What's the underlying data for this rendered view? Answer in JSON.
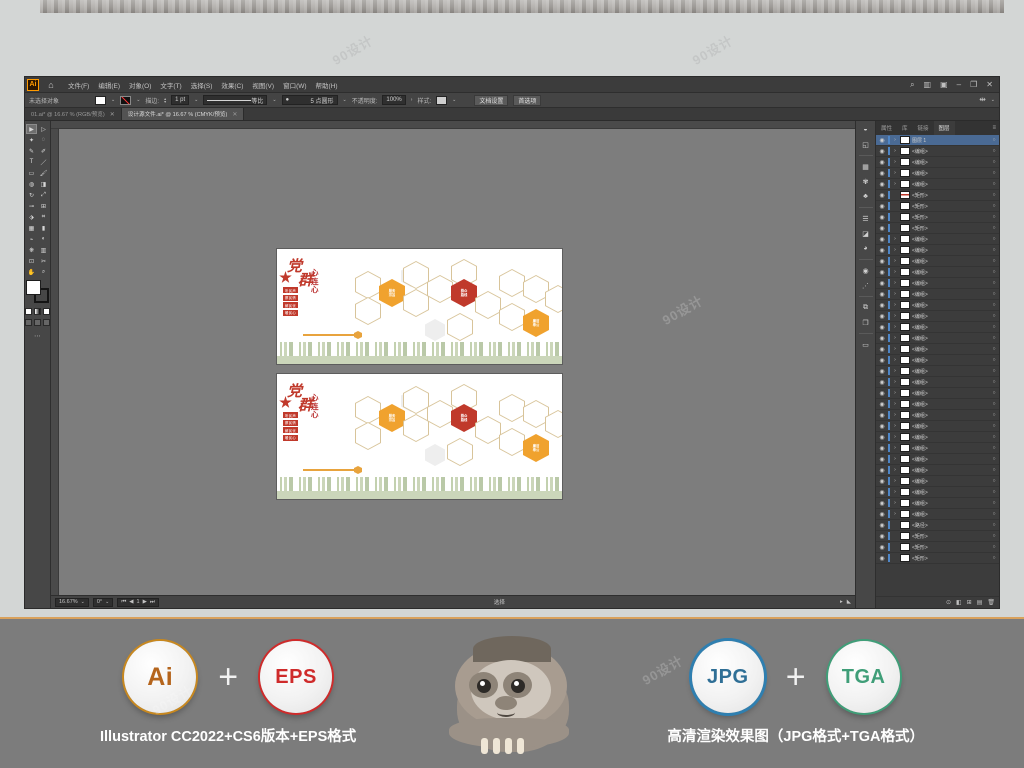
{
  "app": {
    "logo": "Ai",
    "home_icon": "home-icon",
    "menus": [
      "文件(F)",
      "编辑(E)",
      "对象(O)",
      "文字(T)",
      "选择(S)",
      "效果(C)",
      "视图(V)",
      "窗口(W)",
      "帮助(H)"
    ],
    "window_controls": {
      "search": "search-icon",
      "arrange": "arrange-documents-icon",
      "workspace": "workspace-switcher-icon",
      "minimize": "–",
      "restore": "❐",
      "close": "✕"
    }
  },
  "control_bar": {
    "selection_label": "未选择对象",
    "fill_swatch": "#ffffff",
    "stroke_swatch": "none",
    "stroke_label": "描边:",
    "stroke_weight": "1 pt",
    "stroke_profile": "等比",
    "brush_label": "5 点圆形",
    "opacity_label": "不透明度:",
    "opacity_value": "100%",
    "style_label": "样式:",
    "doc_setup_button": "文档设置",
    "preferences_button": "首选项"
  },
  "tabs": [
    {
      "title": "01.ai* @ 16.67 % (RGB/预览)",
      "active": false,
      "close": "✕"
    },
    {
      "title": "设计源文件.ai* @ 16.67 % (CMYK/预览)",
      "active": true,
      "close": "✕"
    }
  ],
  "tools": [
    "selection-tool",
    "direct-selection-tool",
    "magic-wand-tool",
    "lasso-tool",
    "pen-tool",
    "curvature-tool",
    "type-tool",
    "line-segment-tool",
    "rectangle-tool",
    "paintbrush-tool",
    "shaper-tool",
    "eraser-tool",
    "rotate-tool",
    "scale-tool",
    "width-tool",
    "free-transform-tool",
    "shape-builder-tool",
    "perspective-grid-tool",
    "mesh-tool",
    "gradient-tool",
    "eyedropper-tool",
    "blend-tool",
    "symbol-sprayer-tool",
    "column-graph-tool",
    "artboard-tool",
    "slice-tool",
    "hand-tool",
    "zoom-tool"
  ],
  "artwork": {
    "title_char_1": "党",
    "title_char_2": "群",
    "heart_text": [
      "心",
      "连",
      "心"
    ],
    "emblem": "party-emblem-icon",
    "stack_labels": [
      "听民声",
      "察民情",
      "解民忧",
      "暖民心"
    ],
    "hex_labels": [
      {
        "text": "服务\n宗旨",
        "color": "#f0a22e"
      },
      {
        "text": "群众\n路线",
        "color": "#c0392b"
      },
      {
        "text": "廉洁\n奉公",
        "color": "#f0a22e"
      }
    ]
  },
  "status_bar": {
    "zoom": "16.67%",
    "rotation": "0°",
    "artboard_nav": "1",
    "tool_name": "选择"
  },
  "panel": {
    "tabs": [
      "属性",
      "库",
      "链接",
      "图层"
    ],
    "active_tab": "图层",
    "menu_icon": "panel-menu-icon",
    "layers": [
      {
        "name": "图层 1",
        "selected": true,
        "thumb": "white",
        "expandable": true
      },
      {
        "name": "<编组>",
        "selected": false,
        "thumb": "white",
        "expandable": true
      },
      {
        "name": "<编组>",
        "selected": false,
        "thumb": "white",
        "expandable": true
      },
      {
        "name": "<编组>",
        "selected": false,
        "thumb": "white",
        "expandable": true
      },
      {
        "name": "<编组>",
        "selected": false,
        "thumb": "white",
        "expandable": true
      },
      {
        "name": "<矩形>",
        "selected": false,
        "thumb": "red",
        "expandable": false
      },
      {
        "name": "<矩形>",
        "selected": false,
        "thumb": "white",
        "expandable": false
      },
      {
        "name": "<矩形>",
        "selected": false,
        "thumb": "white",
        "expandable": false
      },
      {
        "name": "<矩形>",
        "selected": false,
        "thumb": "white",
        "expandable": false
      },
      {
        "name": "<编组>",
        "selected": false,
        "thumb": "white",
        "expandable": true
      },
      {
        "name": "<编组>",
        "selected": false,
        "thumb": "white",
        "expandable": true
      },
      {
        "name": "<编组>",
        "selected": false,
        "thumb": "white",
        "expandable": true
      },
      {
        "name": "<编组>",
        "selected": false,
        "thumb": "white",
        "expandable": true
      },
      {
        "name": "<编组>",
        "selected": false,
        "thumb": "white",
        "expandable": true
      },
      {
        "name": "<编组>",
        "selected": false,
        "thumb": "white",
        "expandable": true
      },
      {
        "name": "<编组>",
        "selected": false,
        "thumb": "white",
        "expandable": true
      },
      {
        "name": "<编组>",
        "selected": false,
        "thumb": "white",
        "expandable": true
      },
      {
        "name": "<编组>",
        "selected": false,
        "thumb": "white",
        "expandable": true
      },
      {
        "name": "<编组>",
        "selected": false,
        "thumb": "white",
        "expandable": true
      },
      {
        "name": "<编组>",
        "selected": false,
        "thumb": "white",
        "expandable": true
      },
      {
        "name": "<编组>",
        "selected": false,
        "thumb": "white",
        "expandable": true
      },
      {
        "name": "<编组>",
        "selected": false,
        "thumb": "white",
        "expandable": true
      },
      {
        "name": "<编组>",
        "selected": false,
        "thumb": "white",
        "expandable": true
      },
      {
        "name": "<编组>",
        "selected": false,
        "thumb": "white",
        "expandable": true
      },
      {
        "name": "<编组>",
        "selected": false,
        "thumb": "white",
        "expandable": true
      },
      {
        "name": "<编组>",
        "selected": false,
        "thumb": "white",
        "expandable": true
      },
      {
        "name": "<编组>",
        "selected": false,
        "thumb": "white",
        "expandable": true
      },
      {
        "name": "<编组>",
        "selected": false,
        "thumb": "white",
        "expandable": true
      },
      {
        "name": "<编组>",
        "selected": false,
        "thumb": "white",
        "expandable": true
      },
      {
        "name": "<编组>",
        "selected": false,
        "thumb": "white",
        "expandable": true
      },
      {
        "name": "<编组>",
        "selected": false,
        "thumb": "white",
        "expandable": true
      },
      {
        "name": "<编组>",
        "selected": false,
        "thumb": "white",
        "expandable": true
      },
      {
        "name": "<编组>",
        "selected": false,
        "thumb": "white",
        "expandable": true
      },
      {
        "name": "<编组>",
        "selected": false,
        "thumb": "white",
        "expandable": true
      },
      {
        "name": "<编组>",
        "selected": false,
        "thumb": "white",
        "expandable": true
      },
      {
        "name": "<路径>",
        "selected": false,
        "thumb": "white",
        "expandable": false
      },
      {
        "name": "<矩形>",
        "selected": false,
        "thumb": "white",
        "expandable": false
      },
      {
        "name": "<矩形>",
        "selected": false,
        "thumb": "white",
        "expandable": false
      },
      {
        "name": "<矩形>",
        "selected": false,
        "thumb": "white",
        "expandable": false
      }
    ],
    "footer_icons": [
      "locate-object-icon",
      "make-clipping-mask-icon",
      "new-sublayer-icon",
      "new-layer-icon",
      "delete-layer-icon"
    ]
  },
  "banner": {
    "left": {
      "badges": [
        {
          "label": "Ai",
          "color": "#b5651d",
          "ring": "#c8881f"
        },
        {
          "label": "EPS",
          "color": "#cf2b2b",
          "ring": "#cf2b2b"
        }
      ],
      "plus": "+",
      "caption": "Illustrator CC2022+CS6版本+EPS格式"
    },
    "right": {
      "badges": [
        {
          "label": "JPG",
          "color": "#2f6f96",
          "ring": "#2f7fb0"
        },
        {
          "label": "TGA",
          "color": "#3f9e78",
          "ring": "#3f9e78"
        }
      ],
      "plus": "+",
      "caption": "高清渲染效果图（JPG格式+TGA格式）"
    },
    "mascot": "sloth-mascot-icon"
  },
  "watermarks": [
    "90设计",
    "90设计",
    "90设计",
    "90设计",
    "90设计",
    "90设计"
  ]
}
